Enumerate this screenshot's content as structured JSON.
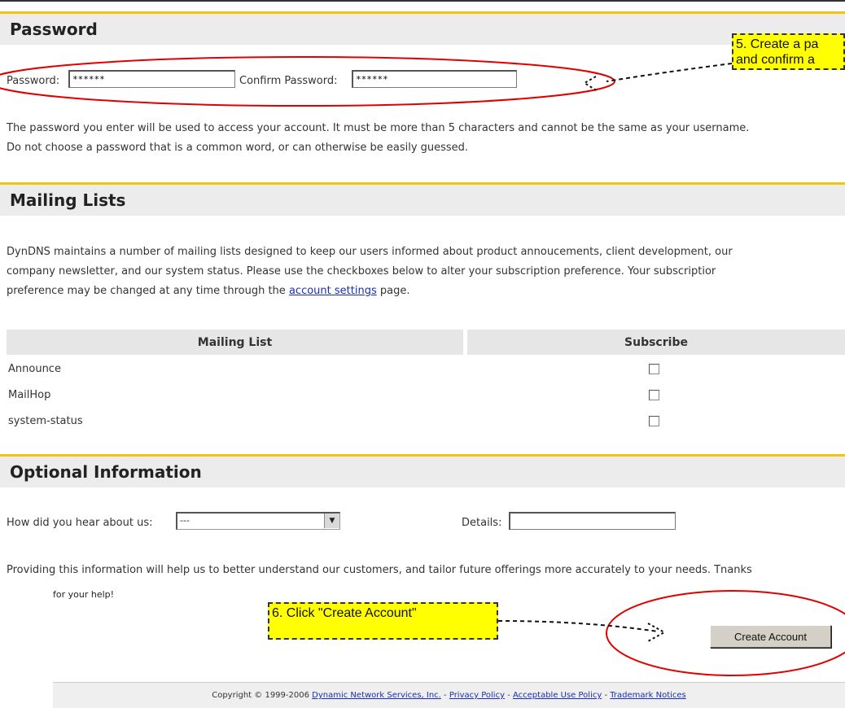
{
  "password_section": {
    "title": "Password",
    "password_label": "Password:",
    "password_value": "******",
    "confirm_label": "Confirm Password:",
    "confirm_value": "******",
    "help_line1": "The password you enter will be used to access your account. It must be more than 5 characters and cannot be the same as your username.",
    "help_line2": "Do not choose a password that is a common word, or can otherwise be easily guessed."
  },
  "callout_5": {
    "line1": "5. Create a pa",
    "line2": "and confirm a"
  },
  "mailing_section": {
    "title": "Mailing Lists",
    "desc_line1": "DynDNS maintains a number of mailing lists designed to keep our users informed about product annoucements, client development, our",
    "desc_line2": "company newsletter, and our system status. Please use the checkboxes below to alter your subscription preference. Your subscriptior",
    "desc_line3_pre": "preference may be changed at any time through the",
    "desc_link": "account settings",
    "desc_line3_post": "page.",
    "col_list": "Mailing List",
    "col_subscribe": "Subscribe",
    "lists": [
      {
        "name": "Announce",
        "checked": false
      },
      {
        "name": "MailHop",
        "checked": false
      },
      {
        "name": "system-status",
        "checked": false
      }
    ]
  },
  "optional_section": {
    "title": "Optional Information",
    "hear_label": "How did you hear about us:",
    "hear_value": "---",
    "details_label": "Details:",
    "details_value": "",
    "info_line1": "Providing this information will help us to better understand our customers, and tailor future offerings more accurately to your needs. Tnanks",
    "info_line2": "for your help!"
  },
  "callout_6": {
    "text": "6. Click \"Create Account\""
  },
  "create_button": "Create Account",
  "footer": {
    "copyright": "Copyright © 1999-2006",
    "company_link": "Dynamic Network Services, Inc.",
    "sep": "-",
    "privacy_link": "Privacy Policy",
    "aup_link": "Acceptable Use Policy",
    "trademark_link": "Trademark Notices"
  },
  "colors": {
    "accent_line": "#f1c40f",
    "annotation_ellipse": "#e00000",
    "callout_bg": "#ffff00",
    "link": "#1a2fb0"
  }
}
